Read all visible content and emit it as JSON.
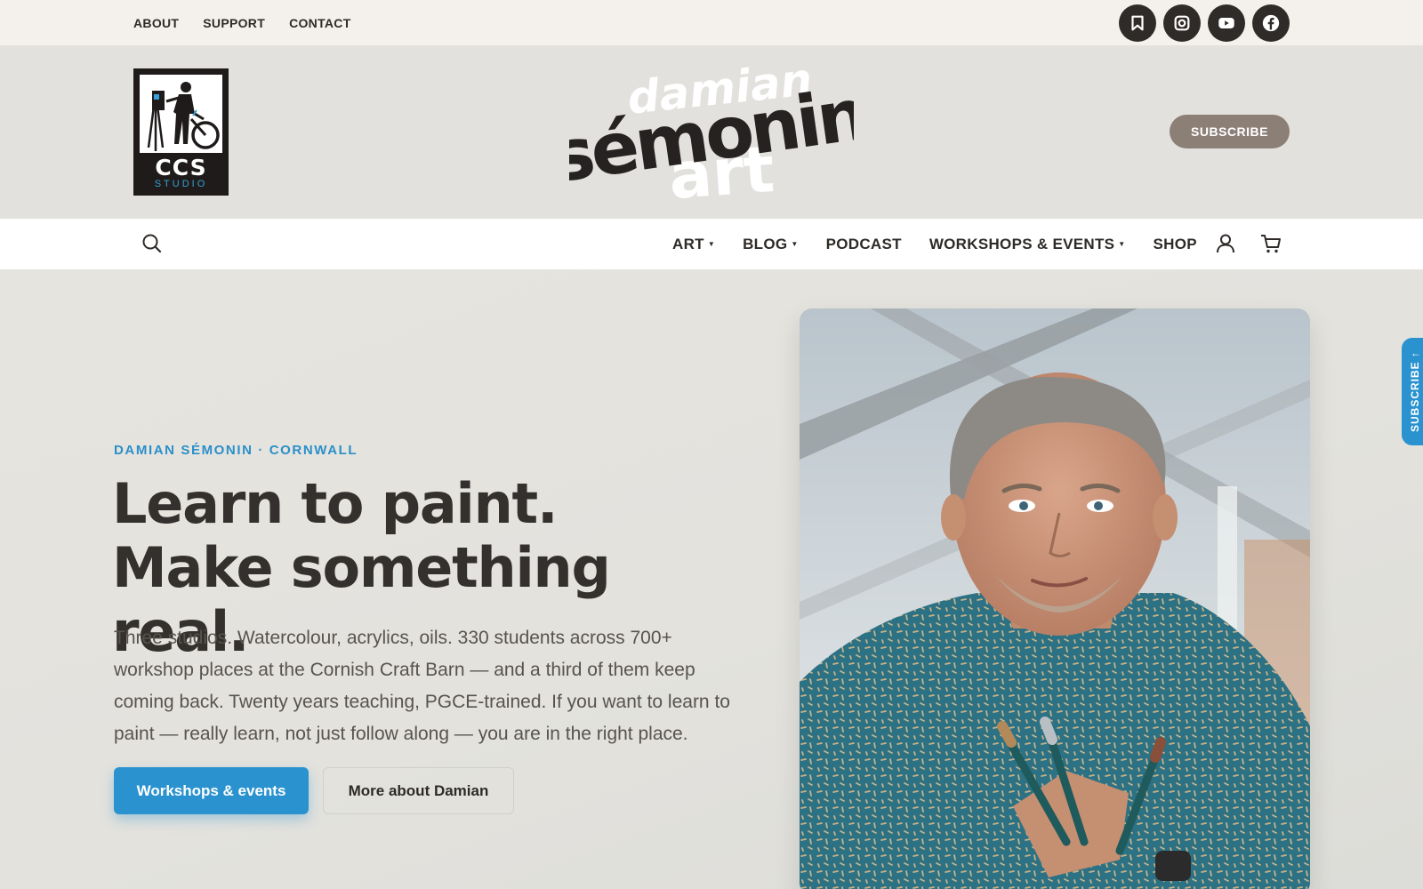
{
  "topbar": {
    "links": [
      "ABOUT",
      "SUPPORT",
      "CONTACT"
    ],
    "socials": [
      "bookmark-icon",
      "instagram-icon",
      "youtube-icon",
      "facebook-icon"
    ]
  },
  "brand": {
    "ccs_logo": {
      "line1": "CCS",
      "line2": "STUDIO"
    },
    "wordmark": {
      "top": "damian",
      "middle": "sémonin",
      "bottom": "art"
    },
    "subscribe_label": "SUBSCRIBE"
  },
  "nav": {
    "items": [
      {
        "label": "ART",
        "has_dropdown": true
      },
      {
        "label": "BLOG",
        "has_dropdown": true
      },
      {
        "label": "PODCAST",
        "has_dropdown": false
      },
      {
        "label": "WORKSHOPS & EVENTS",
        "has_dropdown": true
      },
      {
        "label": "SHOP",
        "has_dropdown": false
      }
    ],
    "icons": [
      "search-icon",
      "account-icon",
      "cart-icon"
    ]
  },
  "hero": {
    "eyebrow": "DAMIAN SÉMONIN · CORNWALL",
    "headline": "Learn to paint. Make something real.",
    "body": "Three studios. Watercolour, acrylics, oils. 330 students across 700+ workshop places at the Cornish Craft Barn — and a third of them keep coming back. Twenty years teaching, PGCE-trained. If you want to learn to paint — really learn, not just follow along — you are in the right place.",
    "primary_cta": "Workshops & events",
    "secondary_cta": "More about Damian"
  },
  "side_tab": {
    "label": "SUBSCRIBE ↑"
  },
  "colors": {
    "accent": "#2a93cf",
    "subscribe": "#8c7f76",
    "topbar_bg": "#f4f1ec",
    "brand_bg": "#e3e1dd",
    "text": "#2e2a28"
  }
}
